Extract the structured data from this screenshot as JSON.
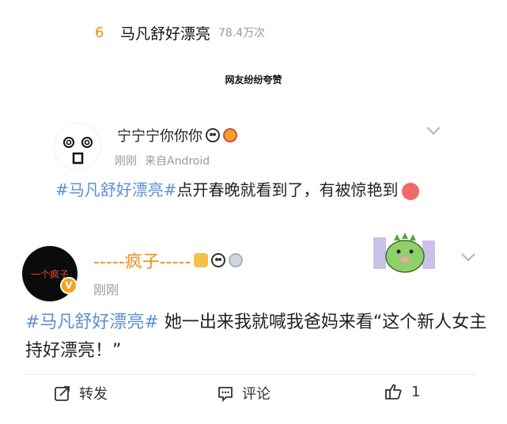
{
  "hot_search": {
    "rank": "6",
    "title": "马凡舒好漂亮",
    "count": "78.4万次"
  },
  "section_caption": "网友纷纷夸赞",
  "posts": [
    {
      "username": "宁宁宁你你你",
      "time": "刚刚",
      "source": "来自Android",
      "hashtag": "#马凡舒好漂亮#",
      "text": "点开春晚就看到了，有被惊艳到",
      "badges": [
        "panda-emoji-icon",
        "orange-badge-icon"
      ],
      "trailing_emoji": "heart-eyes-emoji-icon"
    },
    {
      "username": "-----疯子-----",
      "avatar_text": "一个疯子",
      "verified_mark": "V",
      "time": "刚刚",
      "hashtag": "#马凡舒好漂亮#",
      "text": " 她一出来我就喊我爸妈来看“这个新人女主持好漂亮！”",
      "badges": [
        "crown-badge-icon",
        "panda-emoji-icon",
        "medal-badge-icon"
      ],
      "sticker": "dinosaur-sticker"
    }
  ],
  "actions": {
    "repost": "转发",
    "comment": "评论",
    "like_count": "1"
  },
  "colors": {
    "rank": "#f28b1b",
    "hashtag": "#5b8fd1",
    "username_orange": "#f28b1b",
    "meta_gray": "#9b9b9b"
  }
}
